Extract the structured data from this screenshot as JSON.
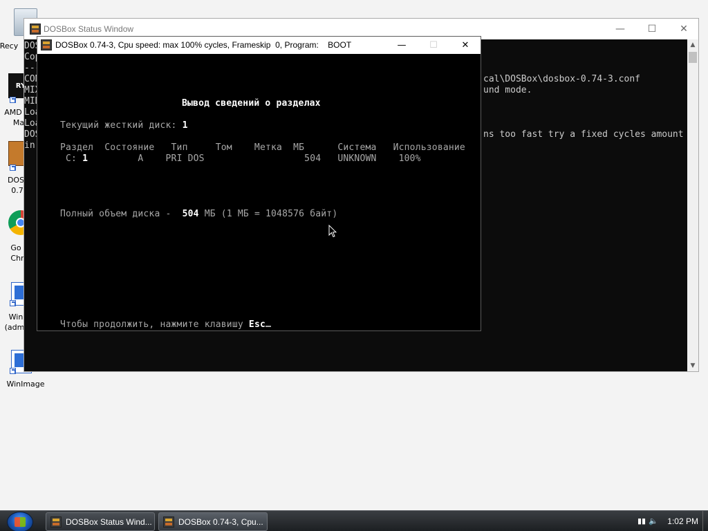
{
  "desktop": {
    "icons": [
      {
        "label": "Recy"
      },
      {
        "label": "AMD"
      },
      {
        "label": "Ma"
      },
      {
        "label": "DOS"
      },
      {
        "label": "0.7"
      },
      {
        "label": "Go"
      },
      {
        "label": "Chr"
      },
      {
        "label": "Win"
      },
      {
        "label": "(adm"
      },
      {
        "label": "WinImage"
      }
    ]
  },
  "status_window": {
    "title": "DOSBox Status Window",
    "left_lines": [
      "DOS",
      "Cop",
      "---",
      "CON",
      "MIX",
      "MID",
      "Loa",
      "Loa",
      "DOS",
      "in "
    ],
    "right_lines": [
      "cal\\DOSBox\\dosbox-0.74-3.conf",
      "und mode.",
      "",
      "",
      "ns too fast try a fixed cycles amount"
    ]
  },
  "dosbox": {
    "title": "DOSBox 0.74-3, Cpu speed: max 100% cycles, Frameskip  0, Program:    BOOT",
    "screen": {
      "heading": "Вывод сведений о разделах",
      "current_disk_label": "Текущий жесткий диск: ",
      "current_disk_value": "1",
      "table_header": "Раздел  Состояние   Тип     Том    Метка  МБ      Система   Использование",
      "row_c_label": " C: ",
      "row_c_num": "1",
      "row_rest": "         A    PRI DOS                  504   UNKNOWN    100%",
      "total_label": "Полный объем диска -  ",
      "total_value": "504",
      "total_rest": " МБ (1 МБ = 1048576 байт)",
      "footer_label": "Чтобы продолжить, нажмите клавишу ",
      "footer_key": "Esc"
    }
  },
  "taskbar": {
    "buttons": [
      {
        "label": "DOSBox Status Wind..."
      },
      {
        "label": "DOSBox 0.74-3, Cpu..."
      }
    ],
    "clock": "1:02 PM"
  }
}
